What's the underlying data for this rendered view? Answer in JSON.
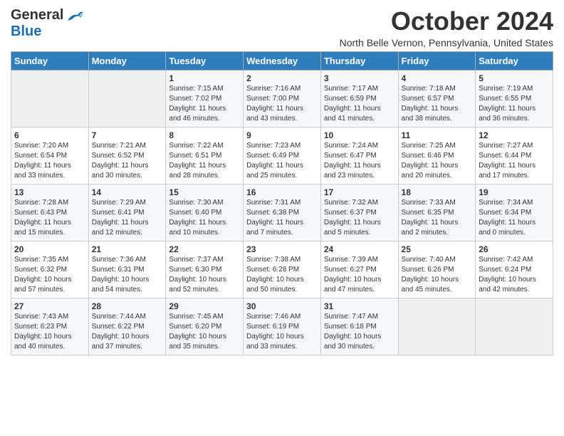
{
  "header": {
    "logo_general": "General",
    "logo_blue": "Blue",
    "month_title": "October 2024",
    "location": "North Belle Vernon, Pennsylvania, United States"
  },
  "weekdays": [
    "Sunday",
    "Monday",
    "Tuesday",
    "Wednesday",
    "Thursday",
    "Friday",
    "Saturday"
  ],
  "weeks": [
    [
      {
        "day": "",
        "info": ""
      },
      {
        "day": "",
        "info": ""
      },
      {
        "day": "1",
        "info": "Sunrise: 7:15 AM\nSunset: 7:02 PM\nDaylight: 11 hours\nand 46 minutes."
      },
      {
        "day": "2",
        "info": "Sunrise: 7:16 AM\nSunset: 7:00 PM\nDaylight: 11 hours\nand 43 minutes."
      },
      {
        "day": "3",
        "info": "Sunrise: 7:17 AM\nSunset: 6:59 PM\nDaylight: 11 hours\nand 41 minutes."
      },
      {
        "day": "4",
        "info": "Sunrise: 7:18 AM\nSunset: 6:57 PM\nDaylight: 11 hours\nand 38 minutes."
      },
      {
        "day": "5",
        "info": "Sunrise: 7:19 AM\nSunset: 6:55 PM\nDaylight: 11 hours\nand 36 minutes."
      }
    ],
    [
      {
        "day": "6",
        "info": "Sunrise: 7:20 AM\nSunset: 6:54 PM\nDaylight: 11 hours\nand 33 minutes."
      },
      {
        "day": "7",
        "info": "Sunrise: 7:21 AM\nSunset: 6:52 PM\nDaylight: 11 hours\nand 30 minutes."
      },
      {
        "day": "8",
        "info": "Sunrise: 7:22 AM\nSunset: 6:51 PM\nDaylight: 11 hours\nand 28 minutes."
      },
      {
        "day": "9",
        "info": "Sunrise: 7:23 AM\nSunset: 6:49 PM\nDaylight: 11 hours\nand 25 minutes."
      },
      {
        "day": "10",
        "info": "Sunrise: 7:24 AM\nSunset: 6:47 PM\nDaylight: 11 hours\nand 23 minutes."
      },
      {
        "day": "11",
        "info": "Sunrise: 7:25 AM\nSunset: 6:46 PM\nDaylight: 11 hours\nand 20 minutes."
      },
      {
        "day": "12",
        "info": "Sunrise: 7:27 AM\nSunset: 6:44 PM\nDaylight: 11 hours\nand 17 minutes."
      }
    ],
    [
      {
        "day": "13",
        "info": "Sunrise: 7:28 AM\nSunset: 6:43 PM\nDaylight: 11 hours\nand 15 minutes."
      },
      {
        "day": "14",
        "info": "Sunrise: 7:29 AM\nSunset: 6:41 PM\nDaylight: 11 hours\nand 12 minutes."
      },
      {
        "day": "15",
        "info": "Sunrise: 7:30 AM\nSunset: 6:40 PM\nDaylight: 11 hours\nand 10 minutes."
      },
      {
        "day": "16",
        "info": "Sunrise: 7:31 AM\nSunset: 6:38 PM\nDaylight: 11 hours\nand 7 minutes."
      },
      {
        "day": "17",
        "info": "Sunrise: 7:32 AM\nSunset: 6:37 PM\nDaylight: 11 hours\nand 5 minutes."
      },
      {
        "day": "18",
        "info": "Sunrise: 7:33 AM\nSunset: 6:35 PM\nDaylight: 11 hours\nand 2 minutes."
      },
      {
        "day": "19",
        "info": "Sunrise: 7:34 AM\nSunset: 6:34 PM\nDaylight: 11 hours\nand 0 minutes."
      }
    ],
    [
      {
        "day": "20",
        "info": "Sunrise: 7:35 AM\nSunset: 6:32 PM\nDaylight: 10 hours\nand 57 minutes."
      },
      {
        "day": "21",
        "info": "Sunrise: 7:36 AM\nSunset: 6:31 PM\nDaylight: 10 hours\nand 54 minutes."
      },
      {
        "day": "22",
        "info": "Sunrise: 7:37 AM\nSunset: 6:30 PM\nDaylight: 10 hours\nand 52 minutes."
      },
      {
        "day": "23",
        "info": "Sunrise: 7:38 AM\nSunset: 6:28 PM\nDaylight: 10 hours\nand 50 minutes."
      },
      {
        "day": "24",
        "info": "Sunrise: 7:39 AM\nSunset: 6:27 PM\nDaylight: 10 hours\nand 47 minutes."
      },
      {
        "day": "25",
        "info": "Sunrise: 7:40 AM\nSunset: 6:26 PM\nDaylight: 10 hours\nand 45 minutes."
      },
      {
        "day": "26",
        "info": "Sunrise: 7:42 AM\nSunset: 6:24 PM\nDaylight: 10 hours\nand 42 minutes."
      }
    ],
    [
      {
        "day": "27",
        "info": "Sunrise: 7:43 AM\nSunset: 6:23 PM\nDaylight: 10 hours\nand 40 minutes."
      },
      {
        "day": "28",
        "info": "Sunrise: 7:44 AM\nSunset: 6:22 PM\nDaylight: 10 hours\nand 37 minutes."
      },
      {
        "day": "29",
        "info": "Sunrise: 7:45 AM\nSunset: 6:20 PM\nDaylight: 10 hours\nand 35 minutes."
      },
      {
        "day": "30",
        "info": "Sunrise: 7:46 AM\nSunset: 6:19 PM\nDaylight: 10 hours\nand 33 minutes."
      },
      {
        "day": "31",
        "info": "Sunrise: 7:47 AM\nSunset: 6:18 PM\nDaylight: 10 hours\nand 30 minutes."
      },
      {
        "day": "",
        "info": ""
      },
      {
        "day": "",
        "info": ""
      }
    ]
  ]
}
